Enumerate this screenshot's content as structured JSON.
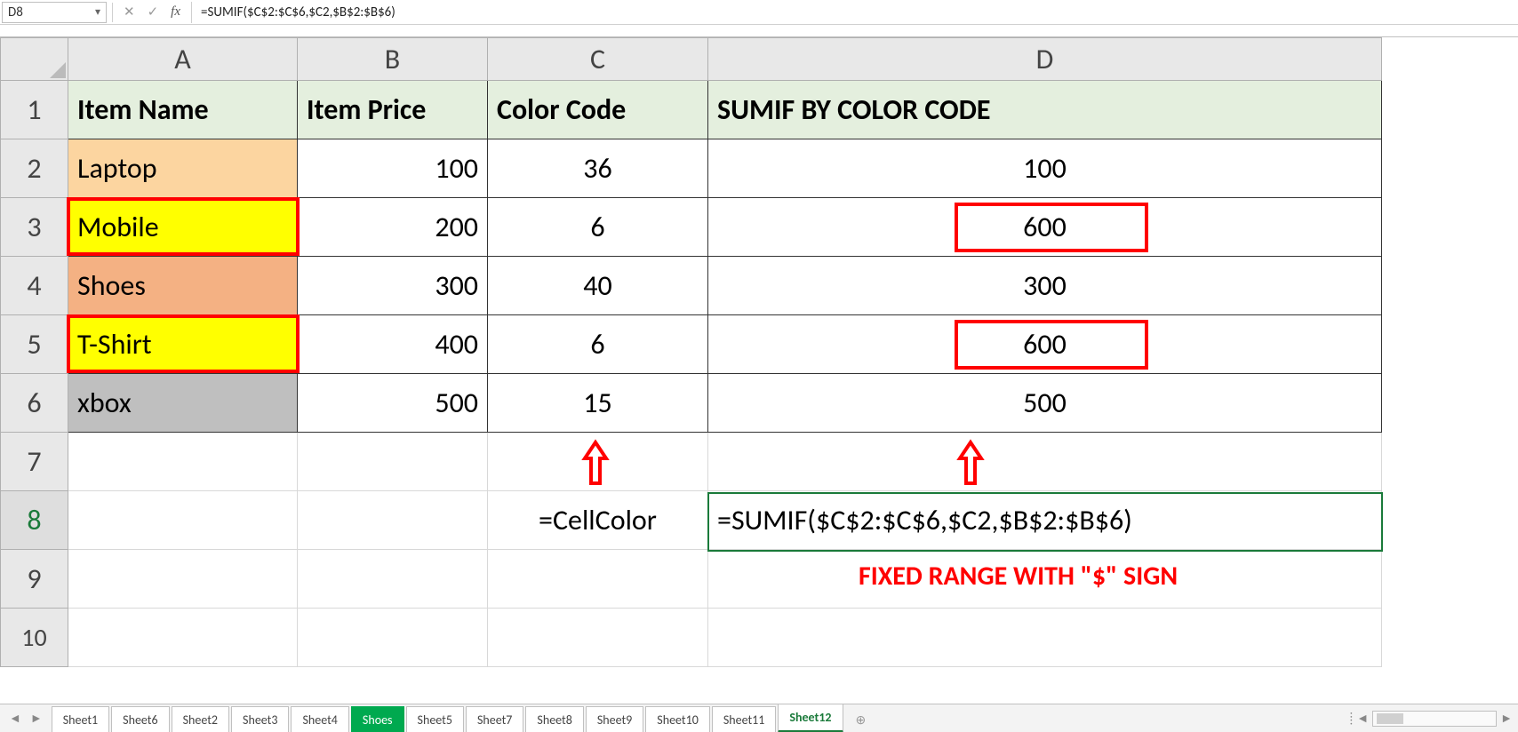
{
  "formula_bar": {
    "namebox": "D8",
    "formula": "=SUMIF($C$2:$C$6,$C2,$B$2:$B$6)"
  },
  "columns": [
    "A",
    "B",
    "C",
    "D"
  ],
  "row_numbers": [
    "1",
    "2",
    "3",
    "4",
    "5",
    "6",
    "7",
    "8",
    "9",
    "10"
  ],
  "headers": {
    "a": "Item Name",
    "b": "Item Price",
    "c": "Color Code",
    "d": "SUMIF BY COLOR CODE"
  },
  "rows": [
    {
      "item": "Laptop",
      "price": "100",
      "code": "36",
      "sumif": "100"
    },
    {
      "item": "Mobile",
      "price": "200",
      "code": "6",
      "sumif": "600"
    },
    {
      "item": "Shoes",
      "price": "300",
      "code": "40",
      "sumif": "300"
    },
    {
      "item": "T-Shirt",
      "price": "400",
      "code": "6",
      "sumif": "600"
    },
    {
      "item": "xbox",
      "price": "500",
      "code": "15",
      "sumif": "500"
    }
  ],
  "row8": {
    "c": "=CellColor",
    "d": "=SUMIF($C$2:$C$6,$C2,$B$2:$B$6)"
  },
  "annotation": "FIXED RANGE WITH \"$\" SIGN",
  "tabs": [
    "Sheet1",
    "Sheet6",
    "Sheet2",
    "Sheet3",
    "Sheet4",
    "Shoes",
    "Sheet5",
    "Sheet7",
    "Sheet8",
    "Sheet9",
    "Sheet10",
    "Sheet11",
    "Sheet12"
  ],
  "active_tab": "Sheet12",
  "green_tab": "Shoes"
}
